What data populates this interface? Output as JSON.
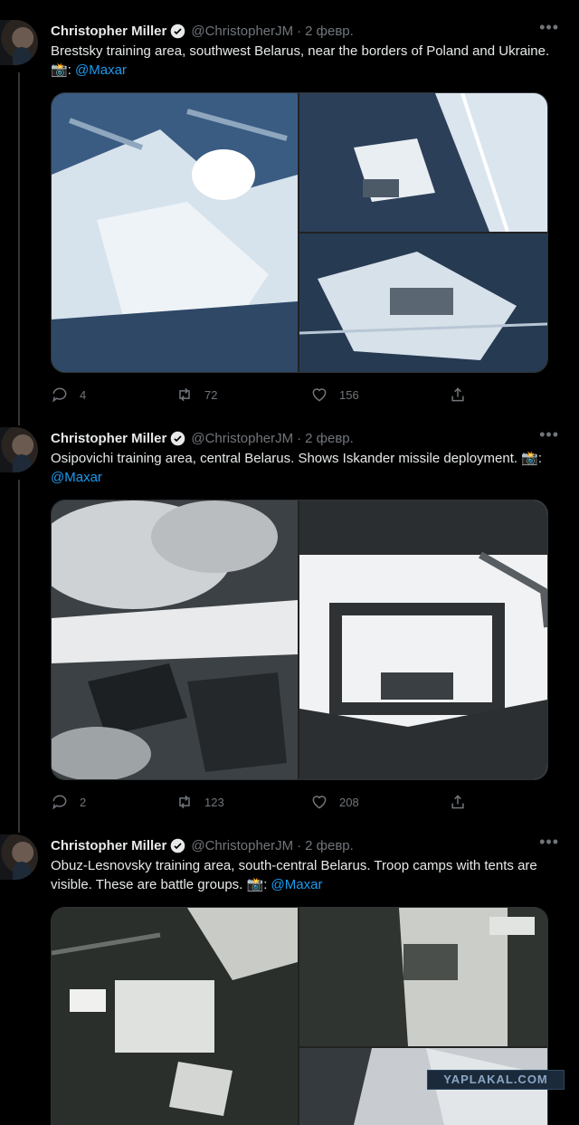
{
  "tweets": [
    {
      "name": "Christopher Miller",
      "handle": "@ChristopherJM",
      "dot": "·",
      "date": "2 февр.",
      "text": "Brestsky training area, southwest Belarus, near the borders of Poland and Ukraine. 📸: ",
      "mention": "@Maxar",
      "replies": "4",
      "retweets": "72",
      "likes": "156"
    },
    {
      "name": "Christopher Miller",
      "handle": "@ChristopherJM",
      "dot": "·",
      "date": "2 февр.",
      "text": "Osipovichi training area, central Belarus. Shows Iskander missile deployment. 📸: ",
      "mention": "@Maxar",
      "replies": "2",
      "retweets": "123",
      "likes": "208"
    },
    {
      "name": "Christopher Miller",
      "handle": "@ChristopherJM",
      "dot": "·",
      "date": "2 февр.",
      "text": "Obuz-Lesnovsky training area, south-central Belarus. Troop camps with tents are visible. These are battle groups. 📸: ",
      "mention": "@Maxar"
    }
  ],
  "more_label": "•••",
  "watermark": "YAPLAKAL.COM",
  "icons": {
    "verified": "verified-badge-icon",
    "reply": "reply-icon",
    "retweet": "retweet-icon",
    "like": "heart-icon",
    "share": "share-icon"
  }
}
